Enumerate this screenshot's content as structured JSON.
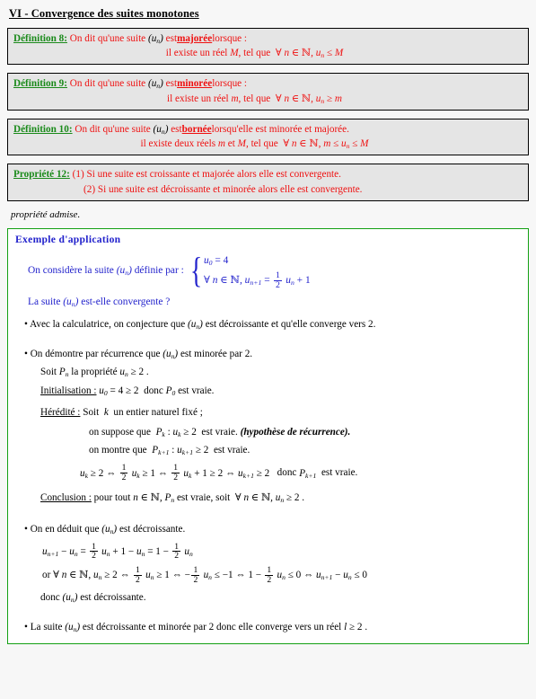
{
  "document": {
    "section_title": "VI - Convergence des suites monotones",
    "note": "propriété admise."
  },
  "colors": {
    "label_green": "#1a8a1a",
    "body_red": "#ef1010",
    "example_blue": "#2222cc",
    "box_border": "#000000",
    "box_background": "#e5e5e5",
    "example_border": "#13a013",
    "page_background": "#f7f7f7"
  },
  "definitions": [
    {
      "label": "Définition 8:",
      "intro_before": "On dit qu'une suite",
      "seq": "(u_n)",
      "intro_mid": "est",
      "keyword": "majorée",
      "intro_after": "lorsque :",
      "statement_prefix": "il existe un réel",
      "statement_var": "M",
      "statement_mid": ", tel que",
      "statement_formula": "∀ n ∈ ℕ, u_n ≤ M"
    },
    {
      "label": "Définition 9:",
      "intro_before": "On dit qu'une suite",
      "seq": "(u_n)",
      "intro_mid": "est",
      "keyword": "minorée",
      "intro_after": "lorsque :",
      "statement_prefix": "il existe un réel",
      "statement_var": "m",
      "statement_mid": ", tel que",
      "statement_formula": "∀ n ∈ ℕ, u_n ≥ m"
    },
    {
      "label": "Définition 10:",
      "intro_before": "On dit qu'une suite",
      "seq": "(u_n)",
      "intro_mid": "est",
      "keyword": "bornée",
      "intro_after": "lorsqu'elle est minorée et majorée.",
      "statement_prefix": "il existe deux réels",
      "statement_var": "m et M",
      "statement_mid": ", tel que",
      "statement_formula": "∀ n ∈ ℕ, m ≤ u_n ≤ M"
    }
  ],
  "property": {
    "label": "Propriété 12:",
    "item1": "(1) Si une suite est croissante et majorée alors elle est convergente.",
    "item2": "(2) Si une suite est décroissante et minorée alors elle est convergente."
  },
  "example": {
    "title": "Exemple d'application",
    "intro": "On considère la suite",
    "intro_seq": "(u_n)",
    "intro_after": "définie par :",
    "system": {
      "row1": "u_0 = 4",
      "row2_prefix": "∀ n ∈ ℕ, u_n+1 =",
      "row2_frac_num": "1",
      "row2_frac_den": "2",
      "row2_suffix": "u_n + 1"
    },
    "question_prefix": "La suite",
    "question_seq": "(u_n)",
    "question_suffix": "est-elle convergente ?",
    "bullet1": {
      "text_before": "Avec la calculatrice, on conjecture que",
      "seq": "(u_n)",
      "text_after": "est décroissante et qu'elle converge vers 2."
    },
    "bullet2": {
      "text_before": "On démontre par récurrence que",
      "seq": "(u_n)",
      "text_after": "est minorée par 2.",
      "soit_prefix": "Soit",
      "soit_prop": "P_n",
      "soit_mid": "la propriété",
      "soit_formula": "u_n ≥ 2 .",
      "initialisation_label": "Initialisation :",
      "initialisation_text": "u_0 = 4 ≥ 2  donc P_0 est vraie.",
      "heredite_label": "Hérédité :",
      "heredite_text": "Soit  k  un entier naturel fixé ;",
      "heredite_line2_prefix": "on suppose que",
      "heredite_line2_formula": "P_k : u_k ≥ 2",
      "heredite_line2_mid": "est vraie.",
      "heredite_line2_note": "(hypothèse de récurrence).",
      "heredite_line3_prefix": "on montre que",
      "heredite_line3_formula": "P_k+1 : u_k+1 ≥ 2",
      "heredite_line3_suffix": "est vraie.",
      "chain": "u_k ≥ 2 ⇔ (1/2) u_k ≥ 1 ⇔ (1/2) u_k + 1 ≥ 2 ⇔ u_k+1 ≥ 2   donc P_k+1 est vraie.",
      "conclusion_label": "Conclusion :",
      "conclusion_text": "pour tout n ∈ ℕ, P_n est vraie, soit  ∀ n ∈ ℕ, u_n ≥ 2 ."
    },
    "bullet3": {
      "text_before": "On en déduit que",
      "seq": "(u_n)",
      "text_after": "est décroissante.",
      "eq1": "u_n+1 − u_n = (1/2) u_n + 1 − u_n = 1 − (1/2) u_n",
      "eq2": "or ∀ n ∈ ℕ, u_n ≥ 2 ⇔ (1/2) u_n ≥ 1 ⇔ −(1/2) u_n ≤ −1 ⇔ 1 − (1/2) u_n ≤ 0 ⇔ u_n+1 − u_n ≤ 0",
      "donc_prefix": "donc",
      "donc_seq": "(u_n)",
      "donc_suffix": "est décroissante."
    },
    "bullet4": {
      "text_before": "La suite",
      "seq": "(u_n)",
      "text_after": "est décroissante et minorée par 2 donc elle converge vers un réel",
      "limit": "l ≥ 2 ."
    }
  }
}
